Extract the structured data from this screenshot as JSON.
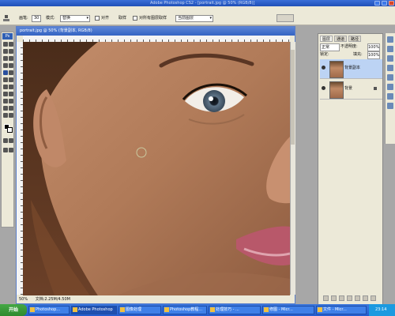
{
  "window": {
    "title": "Adobe Photoshop CS2 - [portrait.jpg @ 50% (RGB/8)]"
  },
  "options_bar": {
    "brush_label": "画笔:",
    "brush_size": "30",
    "mode_label": "模式:",
    "mode_value": "替换",
    "sample_label": "取样",
    "aligned_label": "对齐",
    "all_layers_label": "对所有图层取样",
    "source_value": "当前图层"
  },
  "document": {
    "title": "portrait.jpg @ 50% (背景副本, RGB/8)",
    "status_zoom": "50%",
    "status_doc": "文档:2.25M/4.50M"
  },
  "layers_panel": {
    "tabs": [
      "图层",
      "通道",
      "路径"
    ],
    "blend_mode": "正常",
    "opacity_label": "不透明度:",
    "opacity_value": "100%",
    "lock_label": "锁定:",
    "fill_label": "填充:",
    "fill_value": "100%",
    "layers": [
      {
        "name": "背景副本",
        "selected": true,
        "locked": false
      },
      {
        "name": "背景",
        "selected": false,
        "locked": true
      }
    ]
  },
  "taskbar": {
    "start_label": "开始",
    "items": [
      {
        "label": "Photoshop...",
        "active": false
      },
      {
        "label": "Adobe Photoshop",
        "active": true
      },
      {
        "label": "图像处理",
        "active": false
      },
      {
        "label": "Photoshop教程...",
        "active": false
      },
      {
        "label": "处理技巧 - ...",
        "active": false
      },
      {
        "label": "修图 - Micr...",
        "active": false
      },
      {
        "label": "文件 - Micr...",
        "active": false
      }
    ],
    "clock": "23:14"
  }
}
